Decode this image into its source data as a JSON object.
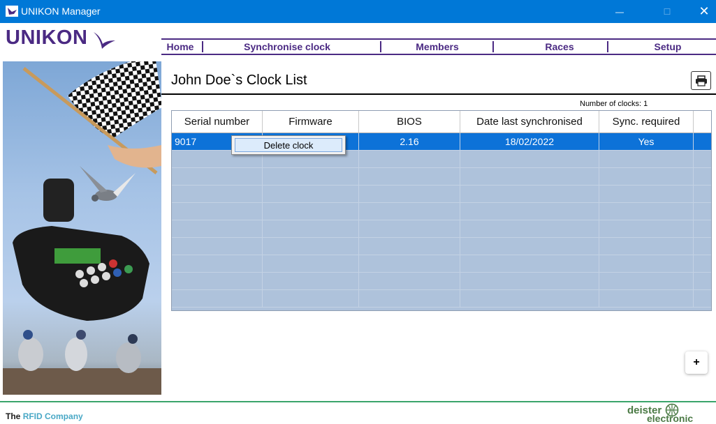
{
  "window": {
    "title": "UNIKON Manager",
    "minimize_glyph": "—",
    "maximize_glyph": "☐",
    "close_glyph": "✕"
  },
  "brand": {
    "name": "UNIKON"
  },
  "nav": {
    "items": [
      {
        "label": "Home"
      },
      {
        "label": "Synchronise clock"
      },
      {
        "label": "Members"
      },
      {
        "label": "Races"
      },
      {
        "label": "Setup"
      }
    ]
  },
  "page": {
    "title": "John Doe`s Clock List",
    "clock_count": "Number of clocks: 1"
  },
  "table": {
    "columns": [
      "Serial number",
      "Firmware",
      "BIOS",
      "Date last synchronised",
      "Sync. required"
    ],
    "rows": [
      {
        "serial": "9017",
        "firmware": "",
        "bios": "2.16",
        "date": "18/02/2022",
        "sync": "Yes",
        "selected": true
      }
    ],
    "empty_rows": 9
  },
  "context_menu": {
    "items": [
      {
        "label": "Delete clock"
      }
    ]
  },
  "add_button": {
    "glyph": "+"
  },
  "footer": {
    "tagline_prefix": "The",
    "tagline_accent": "RFID Company",
    "company_top": "deister",
    "company_bottom": "electronic"
  },
  "colors": {
    "brand_purple": "#4b2a83",
    "titlebar_blue": "#0078d7",
    "selection_blue": "#0d72d8",
    "grid_empty": "#aec2db",
    "footer_green": "#3aa46a"
  },
  "icons": {
    "app": "unikon-bird-icon",
    "print": "printer-icon",
    "add": "plus-icon"
  }
}
